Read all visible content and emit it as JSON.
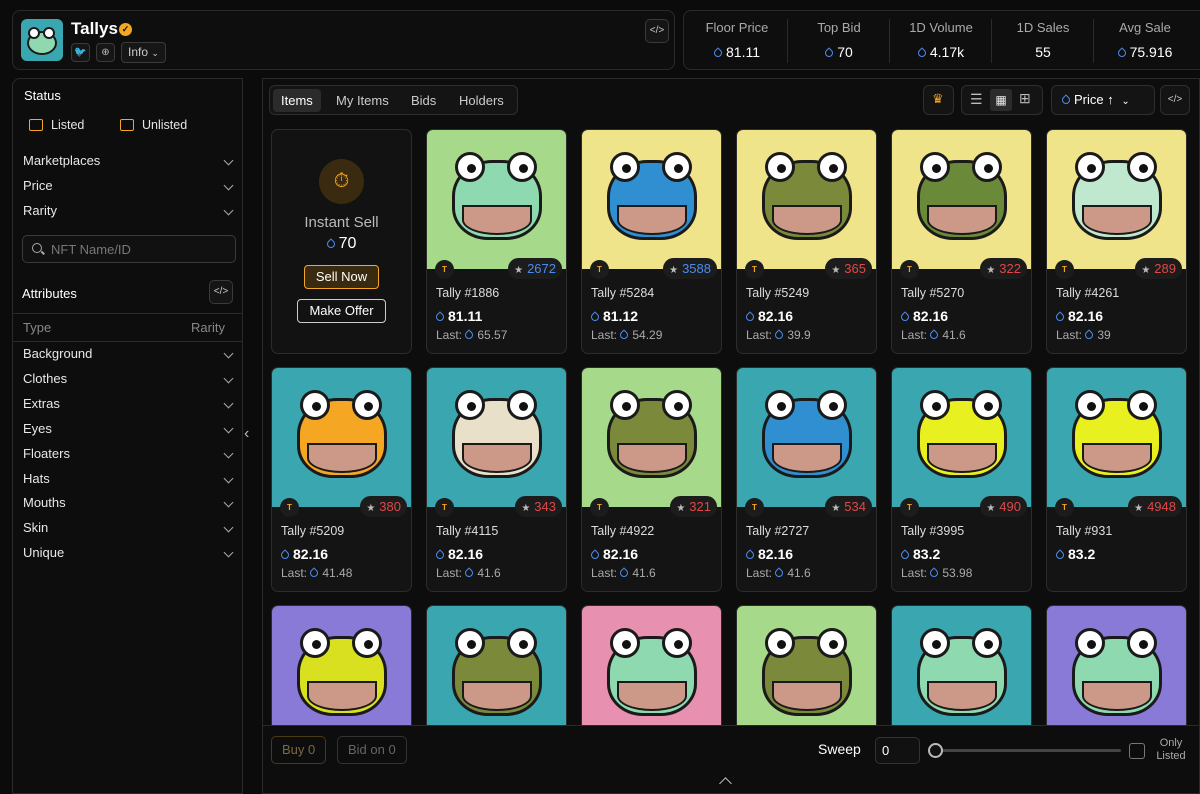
{
  "collection": {
    "title": "Tallys",
    "info_label": "Info"
  },
  "stats": [
    {
      "label": "Floor Price",
      "value": "81.11",
      "drop": true
    },
    {
      "label": "Top Bid",
      "value": "70",
      "drop": true
    },
    {
      "label": "1D Volume",
      "value": "4.17k",
      "drop": true
    },
    {
      "label": "1D Sales",
      "value": "55",
      "drop": false
    },
    {
      "label": "Avg Sale",
      "value": "75.916",
      "drop": true
    }
  ],
  "sidebar": {
    "status_title": "Status",
    "listed": "Listed",
    "unlisted": "Unlisted",
    "filters": [
      "Marketplaces",
      "Price",
      "Rarity"
    ],
    "search_placeholder": "NFT Name/ID",
    "attributes_title": "Attributes",
    "type_header": "Type",
    "rarity_header": "Rarity",
    "attributes": [
      "Background",
      "Clothes",
      "Extras",
      "Eyes",
      "Floaters",
      "Hats",
      "Mouths",
      "Skin",
      "Unique"
    ]
  },
  "tabs": [
    "Items",
    "My Items",
    "Bids",
    "Holders"
  ],
  "sort": {
    "label": "Price",
    "arrow": "↑"
  },
  "instant_sell": {
    "title": "Instant Sell",
    "price": "70",
    "sell_label": "Sell Now",
    "offer_label": "Make Offer"
  },
  "items": [
    {
      "name": "Tally #1886",
      "price": "81.11",
      "last": "65.57",
      "rank": "2672",
      "bg": "#a6d98a",
      "skin": "#8fd9b0",
      "rank_color": "#4a8df0"
    },
    {
      "name": "Tally #5284",
      "price": "81.12",
      "last": "54.29",
      "rank": "3588",
      "bg": "#f0e48a",
      "skin": "#2f8fd0",
      "rank_color": "#4a8df0"
    },
    {
      "name": "Tally #5249",
      "price": "82.16",
      "last": "39.9",
      "rank": "365",
      "bg": "#f0e48a",
      "skin": "#7a8a3a",
      "rank_color": "#e04848"
    },
    {
      "name": "Tally #5270",
      "price": "82.16",
      "last": "41.6",
      "rank": "322",
      "bg": "#f0e48a",
      "skin": "#6a8a3a",
      "rank_color": "#e04848"
    },
    {
      "name": "Tally #4261",
      "price": "82.16",
      "last": "39",
      "rank": "289",
      "bg": "#f0e48a",
      "skin": "#bfe8cf",
      "rank_color": "#e04848"
    },
    {
      "name": "Tally #5209",
      "price": "82.16",
      "last": "41.48",
      "rank": "380",
      "bg": "#3aa7b0",
      "skin": "#f5a623",
      "rank_color": "#e04848"
    },
    {
      "name": "Tally #4115",
      "price": "82.16",
      "last": "41.6",
      "rank": "343",
      "bg": "#3aa7b0",
      "skin": "#e8e0c8",
      "rank_color": "#e04848"
    },
    {
      "name": "Tally #4922",
      "price": "82.16",
      "last": "41.6",
      "rank": "321",
      "bg": "#a6d98a",
      "skin": "#7a8a3a",
      "rank_color": "#e04848"
    },
    {
      "name": "Tally #2727",
      "price": "82.16",
      "last": "41.6",
      "rank": "534",
      "bg": "#3aa7b0",
      "skin": "#2f8fd0",
      "rank_color": "#e04848"
    },
    {
      "name": "Tally #3995",
      "price": "83.2",
      "last": "53.98",
      "rank": "490",
      "bg": "#3aa7b0",
      "skin": "#e8f020",
      "rank_color": "#e04848"
    },
    {
      "name": "Tally #931",
      "price": "83.2",
      "last": "",
      "rank": "4948",
      "bg": "#3aa7b0",
      "skin": "#e8f020",
      "rank_color": "#e04848"
    },
    {
      "name": "",
      "price": "",
      "last": "",
      "rank": "",
      "bg": "#8a7ad8",
      "skin": "#d8e020",
      "rank_color": "#e04848"
    },
    {
      "name": "",
      "price": "",
      "last": "",
      "rank": "",
      "bg": "#3aa7b0",
      "skin": "#7a8a3a",
      "rank_color": "#e04848"
    },
    {
      "name": "",
      "price": "",
      "last": "",
      "rank": "",
      "bg": "#e890b0",
      "skin": "#8fd9b0",
      "rank_color": "#e04848"
    },
    {
      "name": "",
      "price": "",
      "last": "",
      "rank": "",
      "bg": "#a6d98a",
      "skin": "#7a8a3a",
      "rank_color": "#e04848"
    },
    {
      "name": "",
      "price": "",
      "last": "",
      "rank": "",
      "bg": "#3aa7b0",
      "skin": "#8fd9b0",
      "rank_color": "#e04848"
    },
    {
      "name": "",
      "price": "",
      "last": "",
      "rank": "",
      "bg": "#8a7ad8",
      "skin": "#8fd9b0",
      "rank_color": "#e04848"
    }
  ],
  "last_label": "Last:",
  "bottom": {
    "buy": "Buy 0",
    "bid": "Bid on 0",
    "sweep": "Sweep",
    "sweep_value": "0",
    "only_listed": "Only Listed"
  }
}
